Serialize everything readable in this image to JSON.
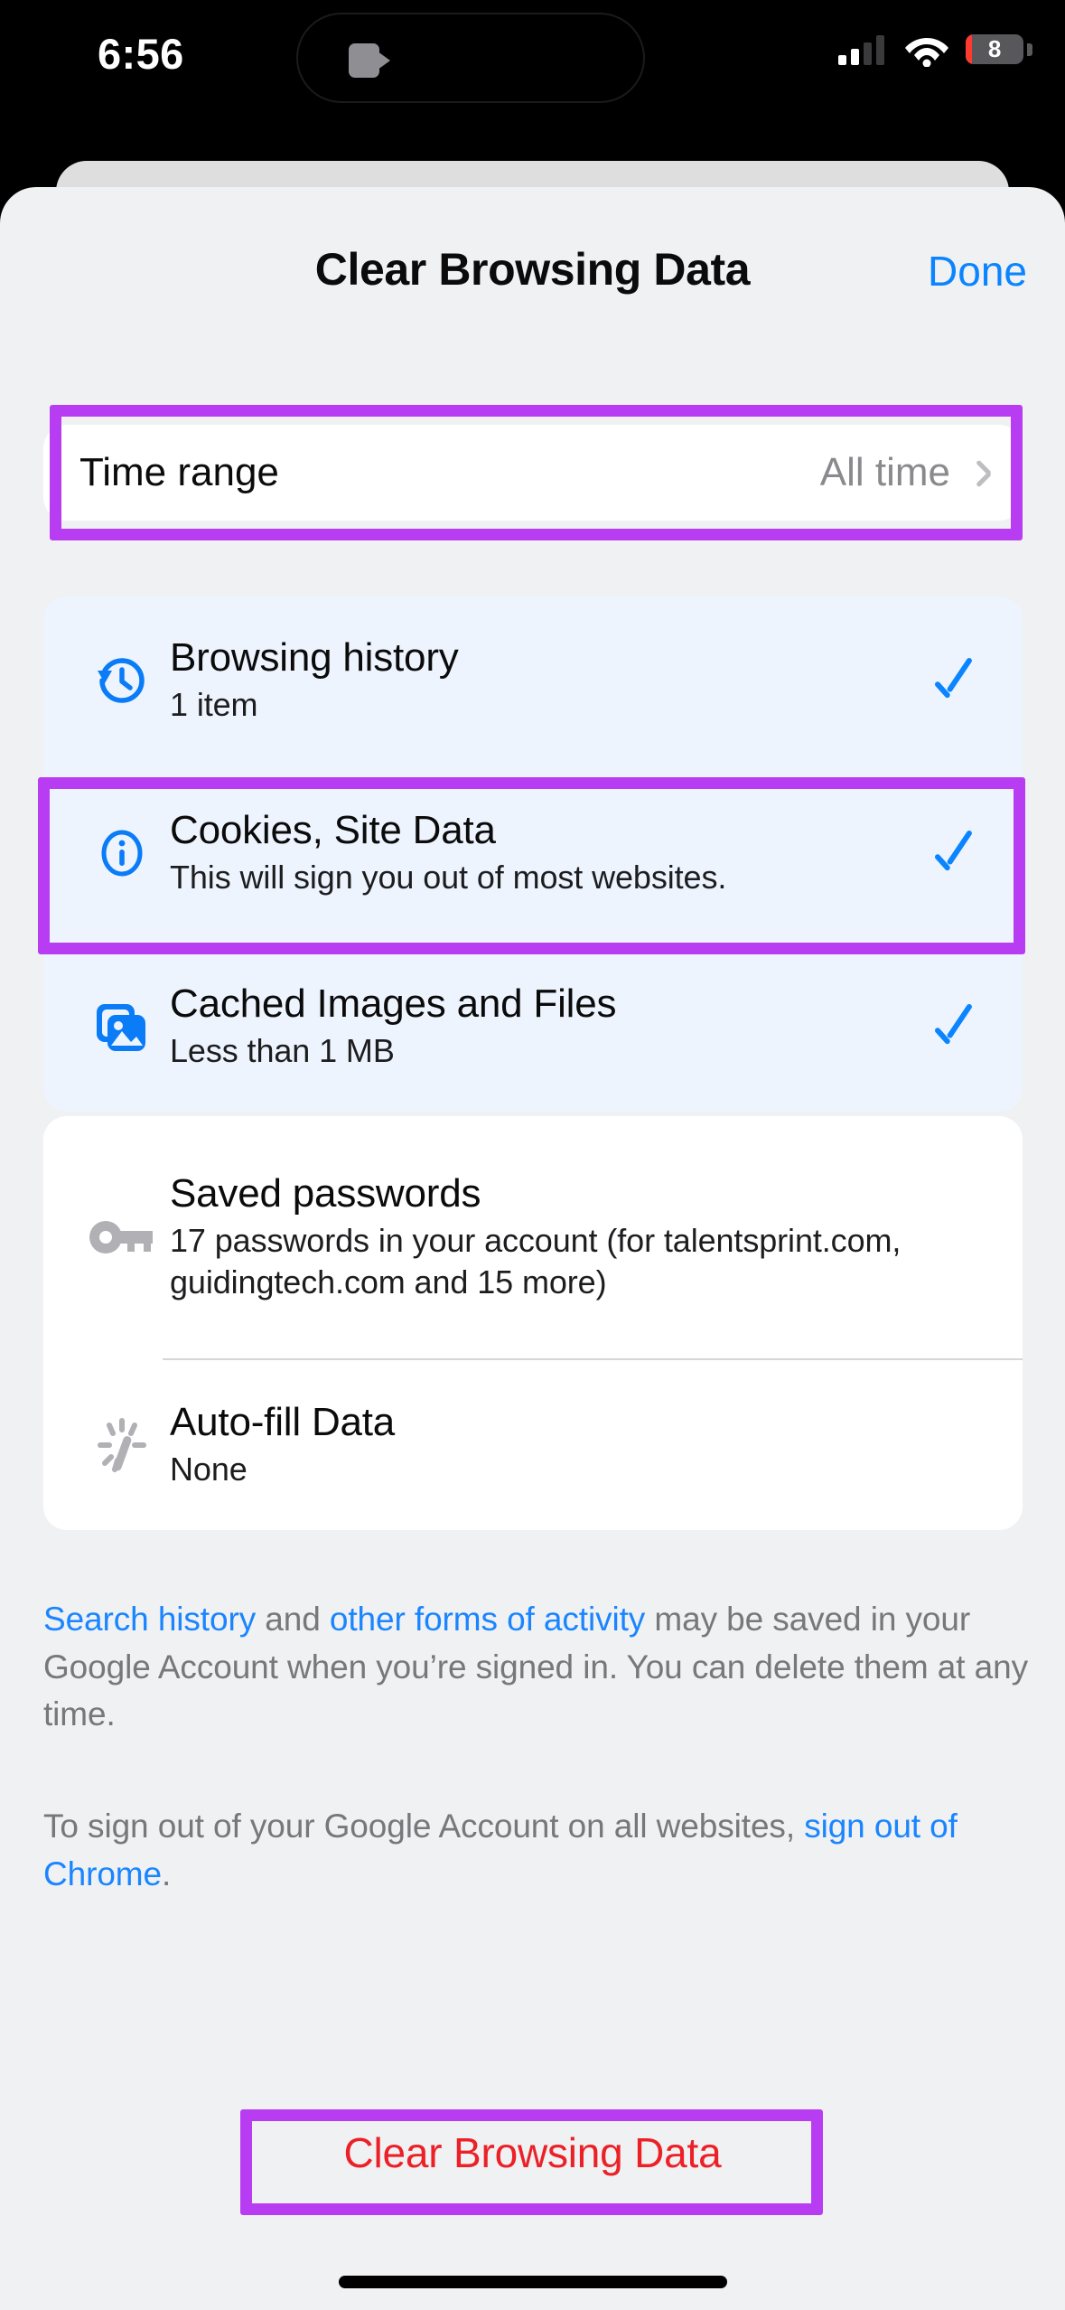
{
  "status_bar": {
    "time": "6:56",
    "battery_percent": "8",
    "icons": [
      "camera-icon",
      "cellular-signal-icon",
      "wifi-icon",
      "battery-icon"
    ]
  },
  "sheet": {
    "title": "Clear Browsing Data",
    "done_label": "Done"
  },
  "time_range": {
    "label": "Time range",
    "value": "All time",
    "chevron": "chevron-right-icon"
  },
  "options": [
    {
      "icon": "history-clock-icon",
      "title": "Browsing history",
      "subtitle": "1 item",
      "checked": true
    },
    {
      "icon": "info-circle-icon",
      "title": "Cookies, Site Data",
      "subtitle": "This will sign you out of most websites.",
      "checked": true
    },
    {
      "icon": "cached-images-icon",
      "title": "Cached Images and Files",
      "subtitle": "Less than 1 MB",
      "checked": true
    },
    {
      "icon": "key-icon",
      "title": "Saved passwords",
      "subtitle": "17 passwords in your account (for talentsprint.com, guidingtech.com and 15 more)",
      "checked": false
    },
    {
      "icon": "autofill-sparkle-icon",
      "title": "Auto-fill Data",
      "subtitle": "None",
      "checked": false
    }
  ],
  "footer": {
    "paragraph1": {
      "link1": "Search history",
      "mid": " and ",
      "link2": "other forms of activity",
      "tail": " may be saved in your Google Account when you’re signed in. You can delete them at any time."
    },
    "paragraph2": {
      "lead": "To sign out of your Google Account on all websites, ",
      "link": "sign out of Chrome",
      "tail": "."
    }
  },
  "clear_button": {
    "label": "Clear Browsing Data"
  },
  "colors": {
    "accent_blue": "#0a84ff",
    "destructive_red": "#ec2027",
    "highlight_purple": "#b83df2",
    "sheet_background": "#eff1f2",
    "selected_row": "#eef4fe"
  }
}
